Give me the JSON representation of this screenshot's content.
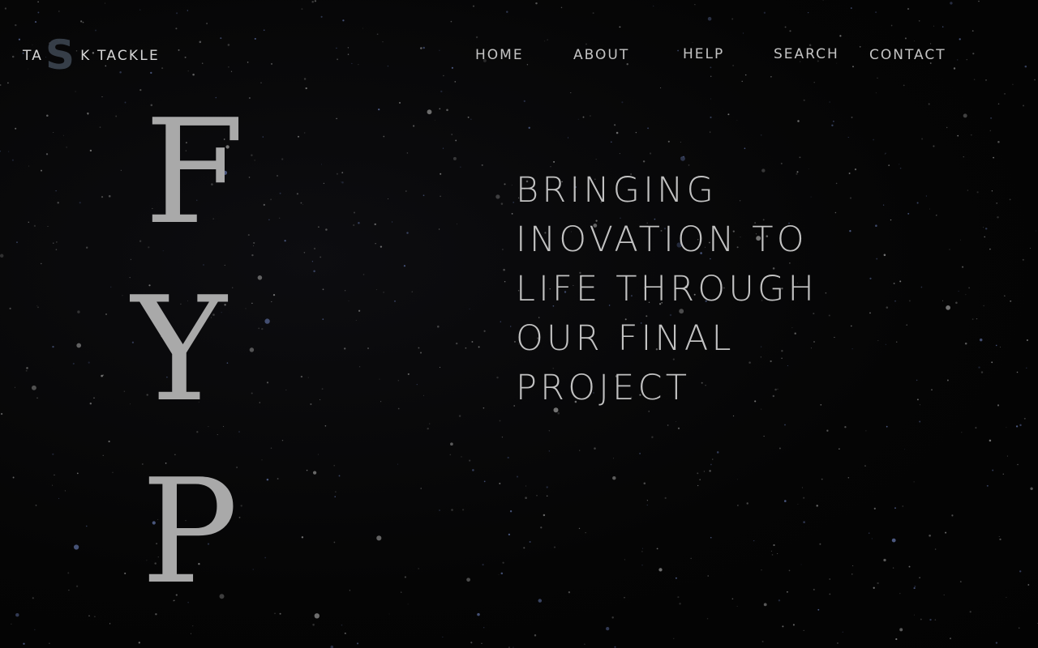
{
  "logo": {
    "prefix": "TA",
    "big_letter": "S",
    "suffix": "K TACKLE"
  },
  "nav": {
    "items": [
      {
        "label": "HOME"
      },
      {
        "label": "ABOUT"
      },
      {
        "label": "HELP"
      },
      {
        "label": "SEARCH"
      },
      {
        "label": "CONTACT"
      }
    ]
  },
  "hero": {
    "letters": [
      "F",
      "Y",
      "P"
    ],
    "headline_lines": [
      "BRINGING",
      "INOVATION TO",
      "LIFE THROUGH",
      "OUR FINAL",
      "PROJECT"
    ]
  },
  "colors": {
    "background": "#050505",
    "text": "#c2c2c2",
    "fyp_letters": "#a9a9a9",
    "logo_accent": "#3c4450"
  }
}
